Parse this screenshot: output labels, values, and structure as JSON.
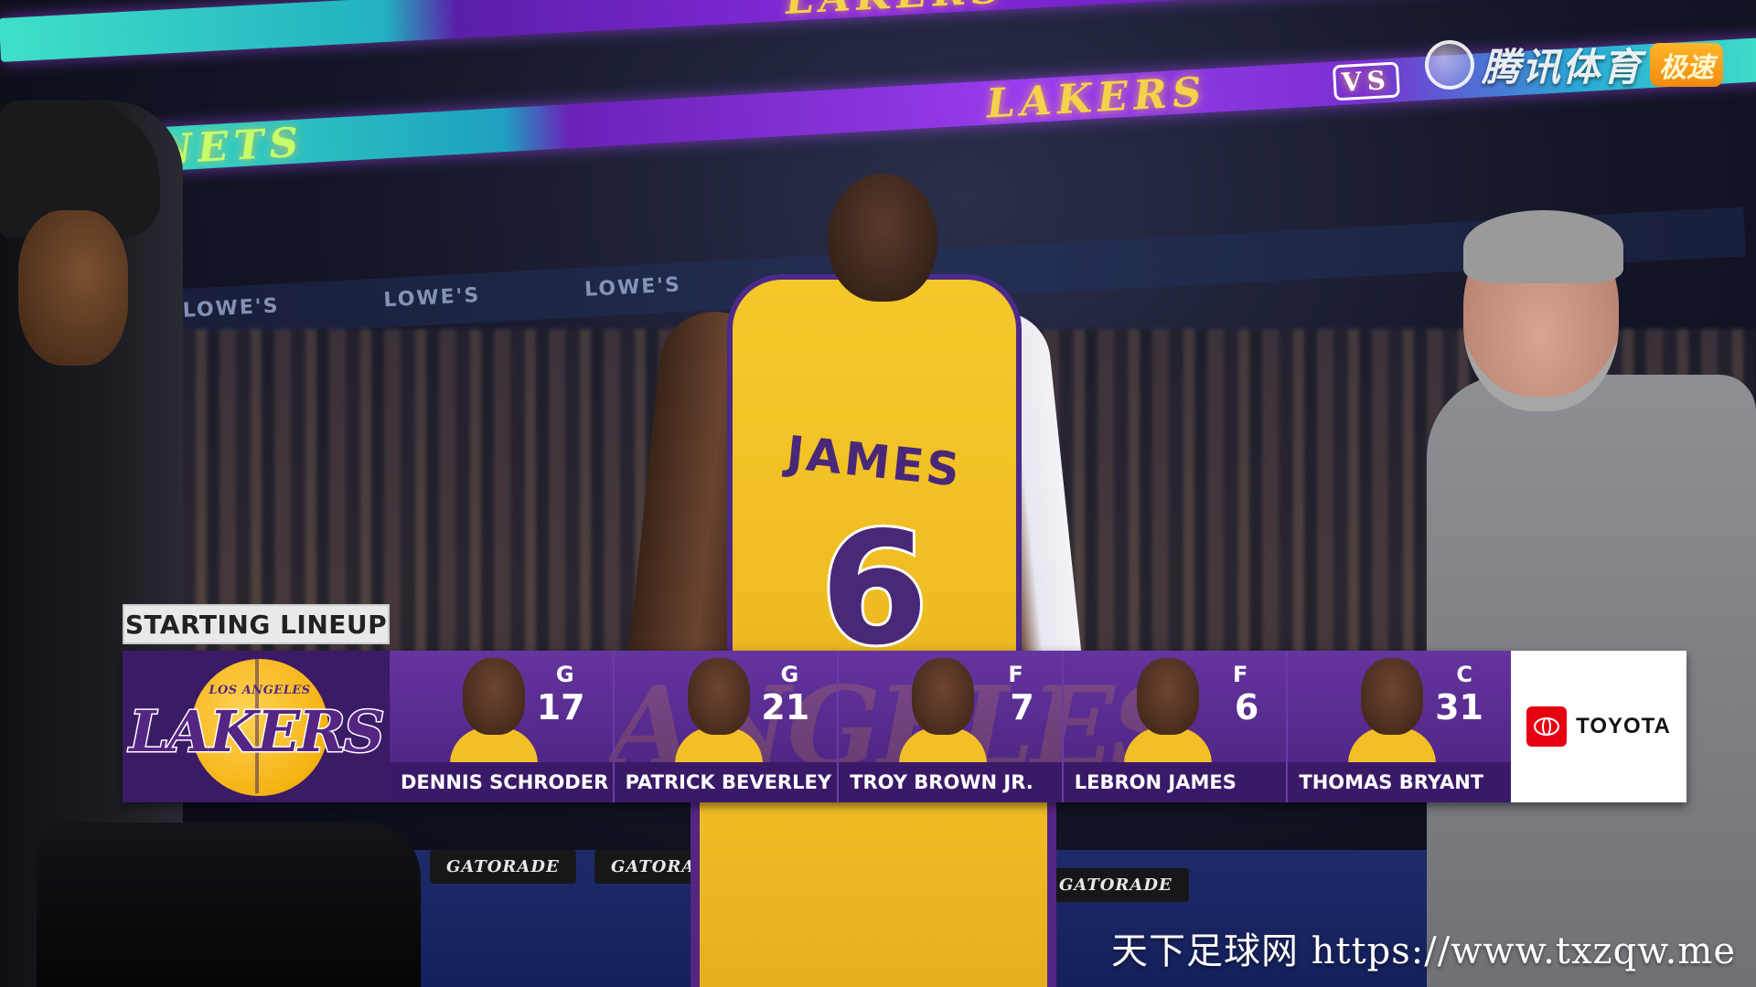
{
  "broadcast": {
    "network": "腾讯体育",
    "badge": "极速"
  },
  "arena": {
    "ribbon_text_1": "LAKERS",
    "ribbon_text_2": "NETS",
    "vs_label": "VS",
    "board_ad": "LOWE'S",
    "courtside_ad": "GATORADE"
  },
  "player_on_court": {
    "jersey_name": "JAMES",
    "jersey_number": "6"
  },
  "lineup": {
    "title": "STARTING LINEUP",
    "team_logo_top": "LOS ANGELES",
    "team_logo_main": "LAKERS",
    "watermark": "LOS ANGELES LAKERS",
    "players": [
      {
        "position": "G",
        "number": "17",
        "name": "DENNIS SCHRODER"
      },
      {
        "position": "G",
        "number": "21",
        "name": "PATRICK BEVERLEY"
      },
      {
        "position": "F",
        "number": "7",
        "name": "TROY BROWN JR."
      },
      {
        "position": "F",
        "number": "6",
        "name": "LEBRON JAMES"
      },
      {
        "position": "C",
        "number": "31",
        "name": "THOMAS BRYANT"
      }
    ],
    "sponsor": "TOYOTA"
  },
  "site_watermark": "天下足球网  https://www.txzqw.me",
  "colors": {
    "lakers_purple": "#552583",
    "lakers_gold": "#F5B312",
    "toyota_red": "#E60012"
  }
}
